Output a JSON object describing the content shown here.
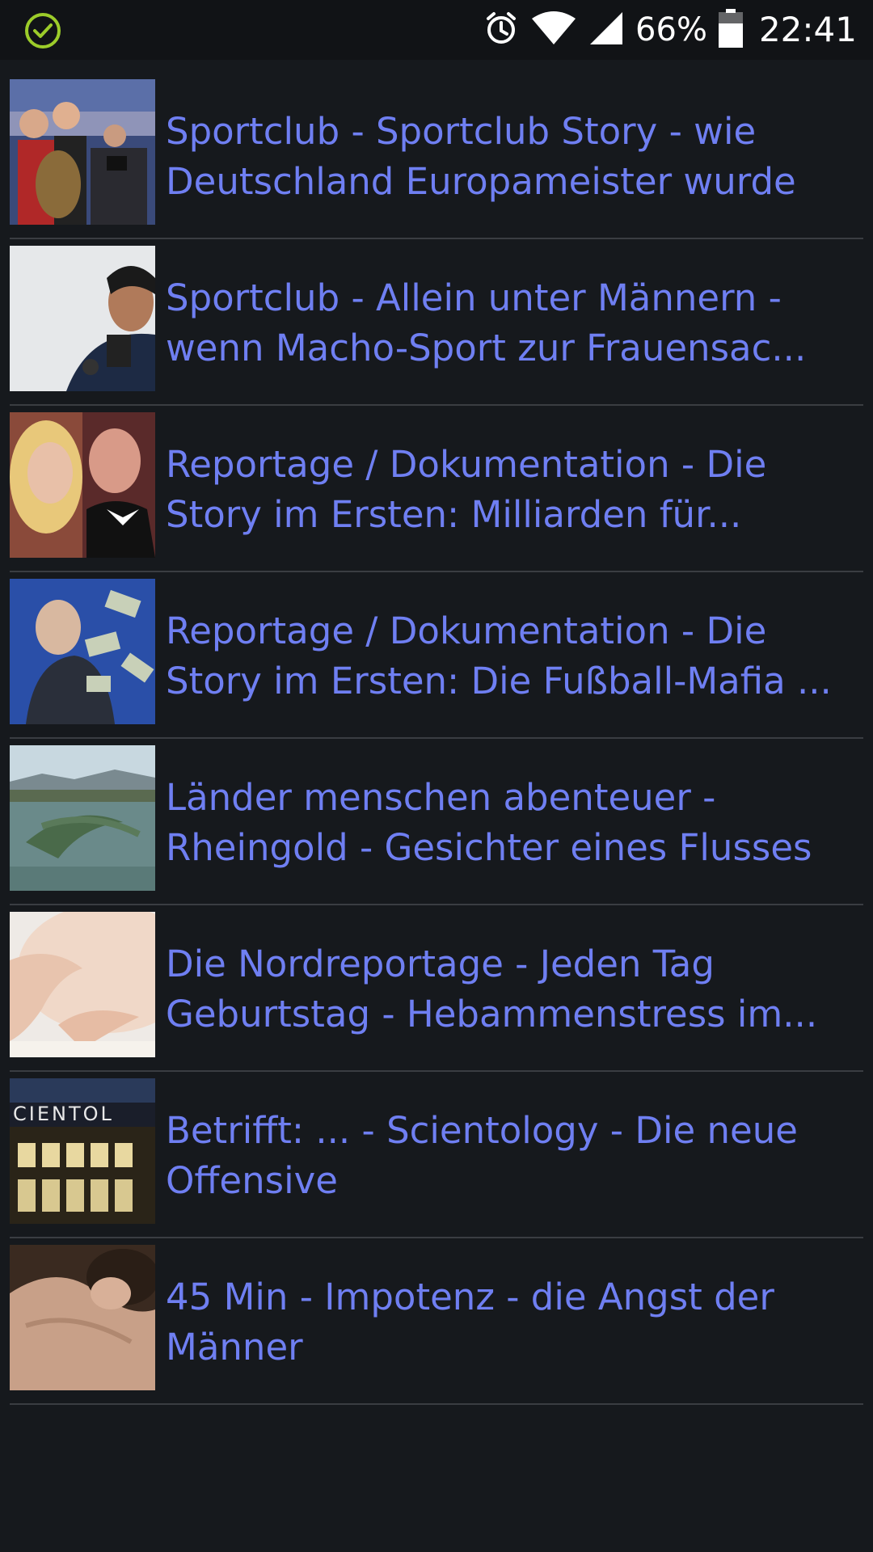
{
  "status_bar": {
    "battery_text": "66%",
    "time": "22:41",
    "icons": [
      "check-circle-icon",
      "alarm-icon",
      "wifi-icon",
      "signal-icon",
      "battery-icon"
    ]
  },
  "items": [
    {
      "line1": "Sportclub - Sportclub Story - wie",
      "line2": "Deutschland Europameister wurde"
    },
    {
      "line1": "Sportclub - Allein unter Männern -",
      "line2": "wenn Macho-Sport zur Frauensac..."
    },
    {
      "line1": "Reportage / Dokumentation - Die",
      "line2": "Story im Ersten: Milliarden für..."
    },
    {
      "line1": "Reportage / Dokumentation - Die",
      "line2": "Story im Ersten: Die Fußball-Mafia ..."
    },
    {
      "line1": "Länder menschen abenteuer -",
      "line2": "Rheingold - Gesichter eines Flusses"
    },
    {
      "line1": "Die Nordreportage - Jeden Tag",
      "line2": "Geburtstag - Hebammenstress im..."
    },
    {
      "line1": "Betrifft: ... - Scientology - Die neue",
      "line2": "Offensive"
    },
    {
      "line1": "45 Min - Impotenz - die Angst der",
      "line2": "Männer"
    }
  ],
  "colors": {
    "background": "#16191d",
    "status_bar": "#111316",
    "title_text": "#6f7ff2",
    "divider": "#3a3d42",
    "check_icon": "#9ccc2a"
  }
}
